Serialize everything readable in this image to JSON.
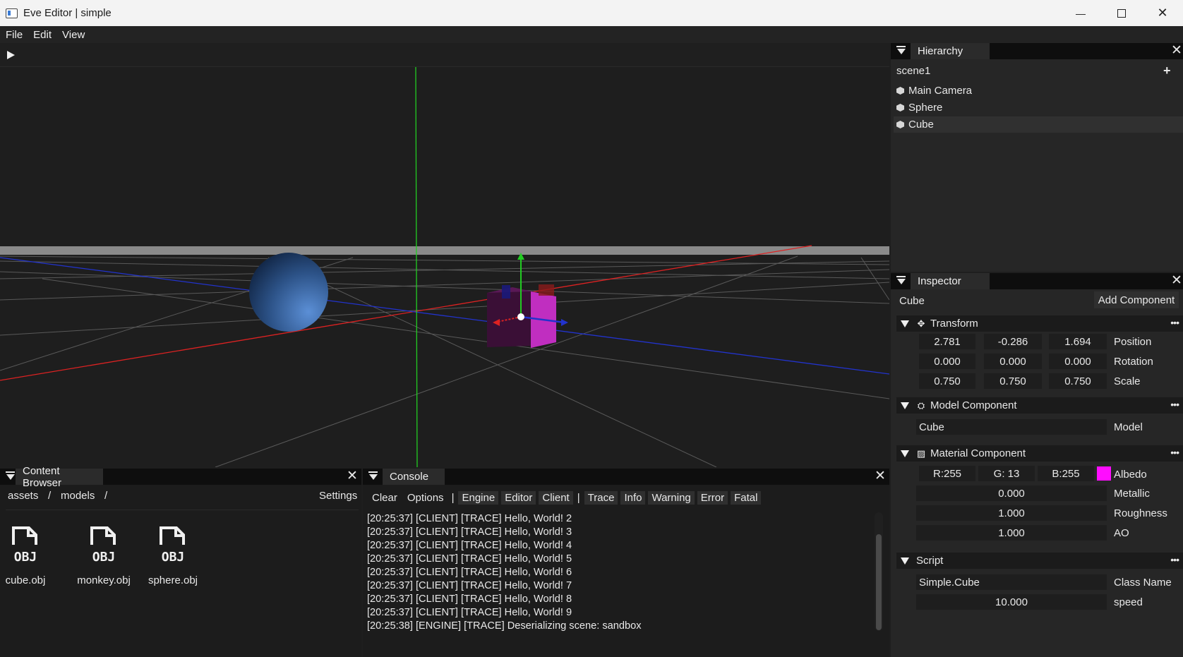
{
  "window": {
    "title": "Eve Editor | simple",
    "minimize": "—",
    "close": "✕"
  },
  "menu": [
    "File",
    "Edit",
    "View"
  ],
  "hierarchy": {
    "tab": "Hierarchy",
    "scene": "scene1",
    "add": "+",
    "items": [
      {
        "label": "Main Camera",
        "selected": false
      },
      {
        "label": "Sphere",
        "selected": false
      },
      {
        "label": "Cube",
        "selected": true
      }
    ]
  },
  "inspector": {
    "tab": "Inspector",
    "object_name": "Cube",
    "add_component": "Add Component",
    "transform": {
      "title": "Transform",
      "position": {
        "x": "2.781",
        "y": "-0.286",
        "z": "1.694",
        "label": "Position"
      },
      "rotation": {
        "x": "0.000",
        "y": "0.000",
        "z": "0.000",
        "label": "Rotation"
      },
      "scale": {
        "x": "0.750",
        "y": "0.750",
        "z": "0.750",
        "label": "Scale"
      }
    },
    "model": {
      "title": "Model Component",
      "value": "Cube",
      "label": "Model"
    },
    "material": {
      "title": "Material Component",
      "r": "R:255",
      "g": "G: 13",
      "b": "B:255",
      "albedo_color": "#ff0dff",
      "albedo_label": "Albedo",
      "metallic": "0.000",
      "metallic_label": "Metallic",
      "roughness": "1.000",
      "roughness_label": "Roughness",
      "ao": "1.000",
      "ao_label": "AO"
    },
    "script": {
      "title": "Script",
      "class_name": "Simple.Cube",
      "class_label": "Class Name",
      "speed": "10.000",
      "speed_label": "speed"
    },
    "more": "•••"
  },
  "content_browser": {
    "tab": "Content Browser",
    "path": [
      "assets",
      "/",
      "models",
      "/"
    ],
    "settings": "Settings",
    "icon_text": "OBJ",
    "files": [
      "cube.obj",
      "monkey.obj",
      "sphere.obj"
    ]
  },
  "console": {
    "tab": "Console",
    "buttons": [
      "Clear",
      "Options"
    ],
    "sep": "|",
    "sources": [
      "Engine",
      "Editor",
      "Client"
    ],
    "levels": [
      "Trace",
      "Info",
      "Warning",
      "Error",
      "Fatal"
    ],
    "lines": [
      "[20:25:37] [CLIENT] [TRACE] Hello, World! 2",
      "[20:25:37] [CLIENT] [TRACE] Hello, World! 3",
      "[20:25:37] [CLIENT] [TRACE] Hello, World! 4",
      "[20:25:37] [CLIENT] [TRACE] Hello, World! 5",
      "[20:25:37] [CLIENT] [TRACE] Hello, World! 6",
      "[20:25:37] [CLIENT] [TRACE] Hello, World! 7",
      "[20:25:37] [CLIENT] [TRACE] Hello, World! 8",
      "[20:25:37] [CLIENT] [TRACE] Hello, World! 9",
      "[20:25:38] [ENGINE] [TRACE] Deserializing scene: sandbox"
    ]
  },
  "colors": {
    "accent_gizmo_y": "#22cc22",
    "accent_gizmo_x": "#dd2222",
    "accent_gizmo_z": "#2233cc",
    "albedo": "#ff0dff"
  }
}
